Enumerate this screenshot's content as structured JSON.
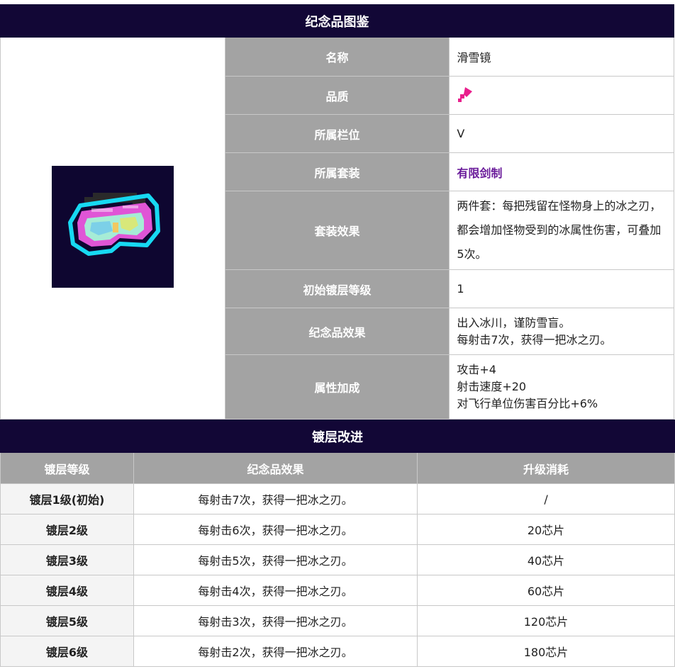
{
  "info": {
    "title": "纪念品图鉴",
    "icon": "ski-goggles-icon",
    "rows": {
      "name": {
        "label": "名称",
        "value": "滑雪镜"
      },
      "quality": {
        "label": "品质",
        "icon": "pink-quality-tag-icon",
        "color": "#e91e8c"
      },
      "slot": {
        "label": "所属栏位",
        "value": "V"
      },
      "set": {
        "label": "所属套装",
        "value": "有限剑制"
      },
      "set_effect": {
        "label": "套装效果",
        "value": "两件套：每把残留在怪物身上的冰之刃，都会增加怪物受到的冰属性伤害，可叠加5次。"
      },
      "initial_level": {
        "label": "初始镀层等级",
        "value": "1"
      },
      "effect": {
        "label": "纪念品效果",
        "lines": [
          "出入冰川，谨防雪盲。",
          "每射击7次，获得一把冰之刃。"
        ]
      },
      "attributes": {
        "label": "属性加成",
        "lines": [
          "攻击+4",
          "射击速度+20",
          "对飞行单位伤害百分比+6%"
        ]
      }
    }
  },
  "upgrade": {
    "title": "镀层改进",
    "headers": [
      "镀层等级",
      "纪念品效果",
      "升级消耗"
    ],
    "rows": [
      {
        "level": "镀层1级(初始)",
        "effect": "每射击7次，获得一把冰之刃。",
        "cost": "/"
      },
      {
        "level": "镀层2级",
        "effect": "每射击6次，获得一把冰之刃。",
        "cost": "20芯片"
      },
      {
        "level": "镀层3级",
        "effect": "每射击5次，获得一把冰之刃。",
        "cost": "40芯片"
      },
      {
        "level": "镀层4级",
        "effect": "每射击4次，获得一把冰之刃。",
        "cost": "60芯片"
      },
      {
        "level": "镀层5级",
        "effect": "每射击3次，获得一把冰之刃。",
        "cost": "120芯片"
      },
      {
        "level": "镀层6级",
        "effect": "每射击2次，获得一把冰之刃。",
        "cost": "180芯片"
      }
    ]
  },
  "colors": {
    "header_bg": "#120736",
    "label_bg": "#a3a3a3",
    "set_link": "#6a1b9a"
  }
}
